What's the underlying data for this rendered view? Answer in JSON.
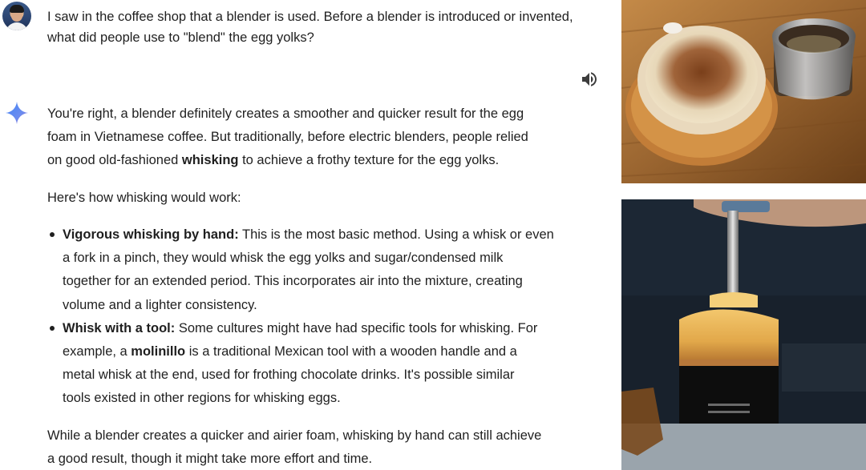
{
  "user_prompt": {
    "lines": [
      "I saw in the coffee shop that a blender is used. Before a blender is introduced or invented,",
      "what did people use to \"blend\" the egg yolks?"
    ]
  },
  "response": {
    "intro_lines": [
      "You're right, a blender definitely creates a smoother and quicker result for the egg",
      "foam in Vietnamese coffee. But traditionally, before electric blenders, people relied"
    ],
    "intro_line3": {
      "before": "on good old-fashioned ",
      "bold": "whisking",
      "after": " to achieve a frothy texture for the egg yolks."
    },
    "how_intro": "Here's how whisking would work:",
    "bullets": [
      {
        "title": "Vigorous whisking by hand:",
        "first_rest": " This is the most basic method. Using a whisk or even",
        "lines": [
          "a fork in a pinch, they would whisk the egg yolks and sugar/condensed milk",
          "together for an extended period. This incorporates air into the mixture, creating",
          "volume and a lighter consistency."
        ]
      },
      {
        "title": "Whisk with a tool:",
        "first_rest": " Some cultures might have had specific tools for whisking. For",
        "line2_before": "example, a ",
        "line2_bold": "molinillo",
        "line2_after": " is a traditional Mexican tool with a wooden handle and a",
        "lines": [
          "metal whisk at the end, used for frothing chocolate drinks. It's possible similar",
          "tools existed in other regions for whisking eggs."
        ]
      }
    ],
    "closing_lines": [
      "While a blender creates a quicker and airier foam, whisking by hand can still achieve",
      "a good result, though it might take more effort and time."
    ]
  },
  "icons": {
    "avatar": "user-avatar",
    "speaker": "speaker-icon",
    "gemini": "gemini-sparkle-icon"
  },
  "colors": {
    "text": "#1f1f1f",
    "gemini_blue": "#4285f4",
    "gemini_purple": "#9b72cb"
  }
}
